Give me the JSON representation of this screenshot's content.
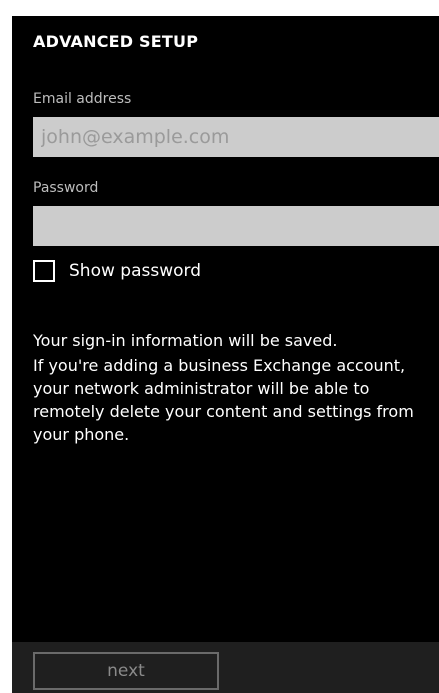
{
  "header": {
    "title": "ADVANCED SETUP"
  },
  "form": {
    "email_label": "Email address",
    "email_value": "",
    "email_placeholder": "john@example.com",
    "password_label": "Password",
    "password_value": "",
    "show_password_label": "Show password",
    "show_password_checked": false
  },
  "info": {
    "line1": "Your sign-in information will be saved.",
    "line2": "If you're adding a business Exchange account, your network administrator will be able to remotely delete your content and settings from your phone."
  },
  "app_bar": {
    "next_label": "next",
    "next_enabled": false
  },
  "colors": {
    "background": "#000000",
    "field_background": "#cccccc",
    "app_bar_background": "#1f1f1f",
    "disabled_text": "#8a8a8a"
  }
}
